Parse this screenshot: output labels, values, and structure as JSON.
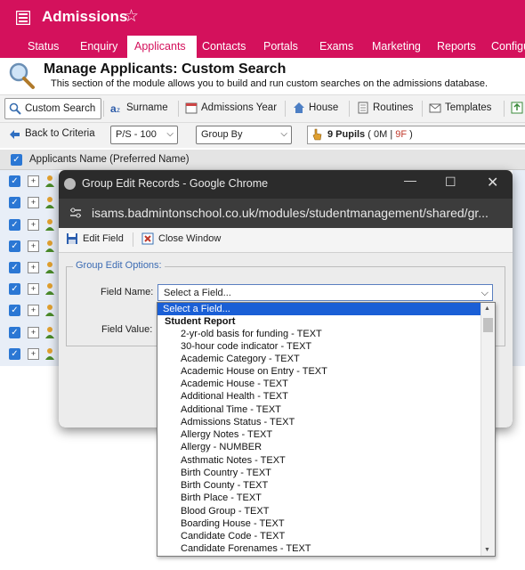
{
  "header": {
    "title": "Admissions",
    "star_glyph": "☆",
    "accent": "#d4115c"
  },
  "nav": {
    "tabs": [
      {
        "label": "Status"
      },
      {
        "label": "Enquiry"
      },
      {
        "label": "Applicants"
      },
      {
        "label": "Contacts"
      },
      {
        "label": "Portals"
      },
      {
        "label": "Exams"
      },
      {
        "label": "Marketing"
      },
      {
        "label": "Reports"
      },
      {
        "label": "Configu"
      }
    ],
    "active": "Applicants"
  },
  "page": {
    "title": "Manage Applicants: Custom Search",
    "description": "This section of the module allows you to build and run custom searches on the admissions database."
  },
  "toolbar": {
    "custom_search": "Custom Search",
    "surname": "Surname",
    "admissions_year": "Admissions Year",
    "house": "House",
    "routines": "Routines",
    "templates": "Templates"
  },
  "toolbar2": {
    "back": "Back to Criteria",
    "page_size": "P/S - 100",
    "group_by": "Group By",
    "pupils_label": "9 Pupils",
    "pupils_om": "0M",
    "pupils_f": "9F"
  },
  "grid": {
    "column_header": "Applicants Name (Preferred Name)",
    "row_count": 9
  },
  "popup": {
    "window_title": "Group Edit Records - Google Chrome",
    "url": "isams.badmintonschool.co.uk/modules/studentmanagement/shared/gr...",
    "edit_field": "Edit Field",
    "close_window": "Close Window",
    "legend": "Group Edit Options:",
    "field_name_label": "Field Name:",
    "field_value_label": "Field Value:",
    "field_select_value": "Select a Field..."
  },
  "dropdown": {
    "selected": "Select a Field...",
    "group": "Student Report",
    "options": [
      "2-yr-old basis for funding - TEXT",
      "30-hour code indicator - TEXT",
      "Academic Category - TEXT",
      "Academic House on Entry - TEXT",
      "Academic House - TEXT",
      "Additional Health - TEXT",
      "Additional Time - TEXT",
      "Admissions Status - TEXT",
      "Allergy Notes - TEXT",
      "Allergy - NUMBER",
      "Asthmatic Notes - TEXT",
      "Birth Country - TEXT",
      "Birth County - TEXT",
      "Birth Place - TEXT",
      "Blood Group - TEXT",
      "Boarding House - TEXT",
      "Candidate Code - TEXT",
      "Candidate Forenames - TEXT"
    ]
  }
}
